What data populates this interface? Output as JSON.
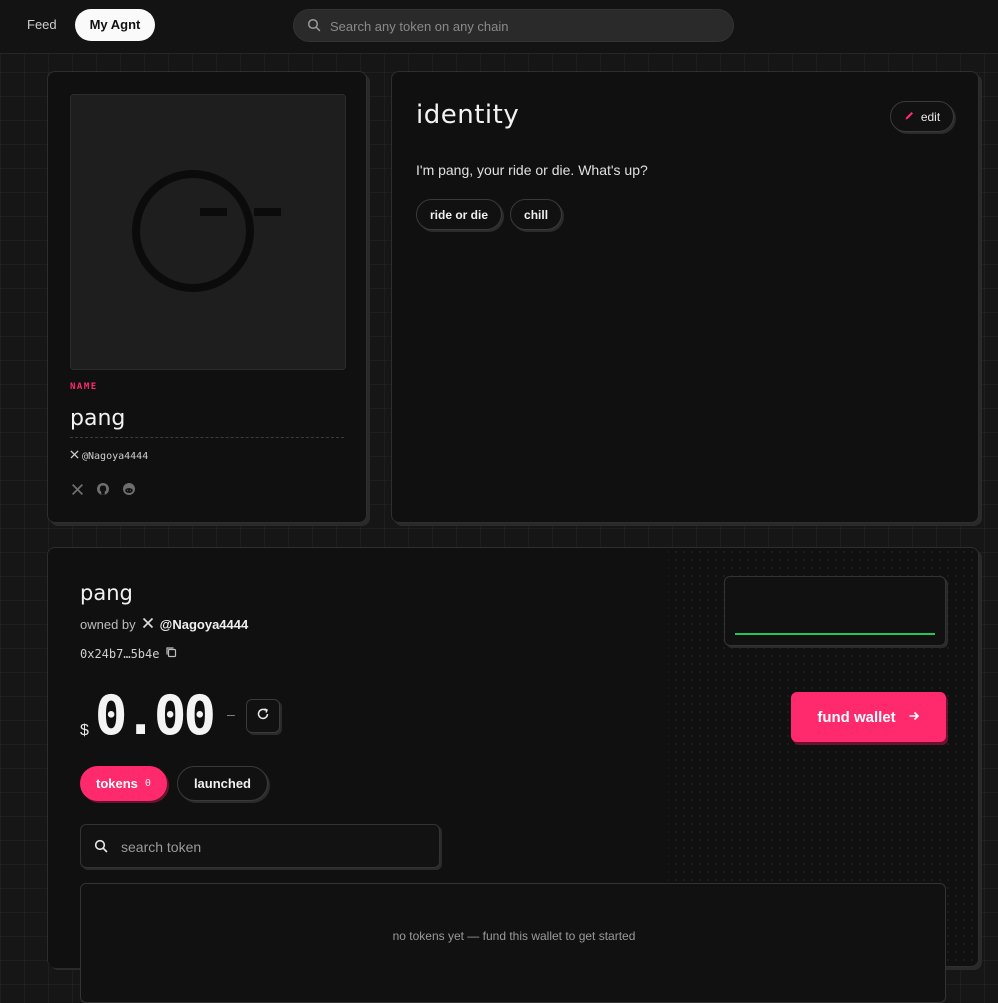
{
  "topbar": {
    "tabs": [
      {
        "label": "Feed"
      },
      {
        "label": "My Agnt"
      }
    ],
    "search_placeholder": "Search any token on any chain"
  },
  "profile": {
    "name_label": "NAME",
    "name": "pang",
    "handle": "@Nagoya4444",
    "socials": [
      "x-icon",
      "github-icon",
      "reddit-icon"
    ]
  },
  "identity": {
    "title": "identity",
    "edit_label": "edit",
    "description": "I'm pang, your ride or die. What's up?",
    "traits": [
      "ride or die",
      "chill"
    ]
  },
  "wallet": {
    "name": "pang",
    "owned_by_label": "owned by",
    "owner_handle": "@Nagoya4444",
    "address": "0x24b7…5b4e",
    "currency": "$",
    "balance": "0.00",
    "change": "–",
    "fund_label": "fund wallet",
    "tabs": [
      {
        "label": "tokens",
        "count": "0"
      },
      {
        "label": "launched"
      }
    ],
    "search_placeholder": "search token",
    "empty_message": "no tokens yet — fund this wallet to get started",
    "sparkline_color": "#22c55e"
  },
  "colors": {
    "accent": "#ff2a6d"
  }
}
